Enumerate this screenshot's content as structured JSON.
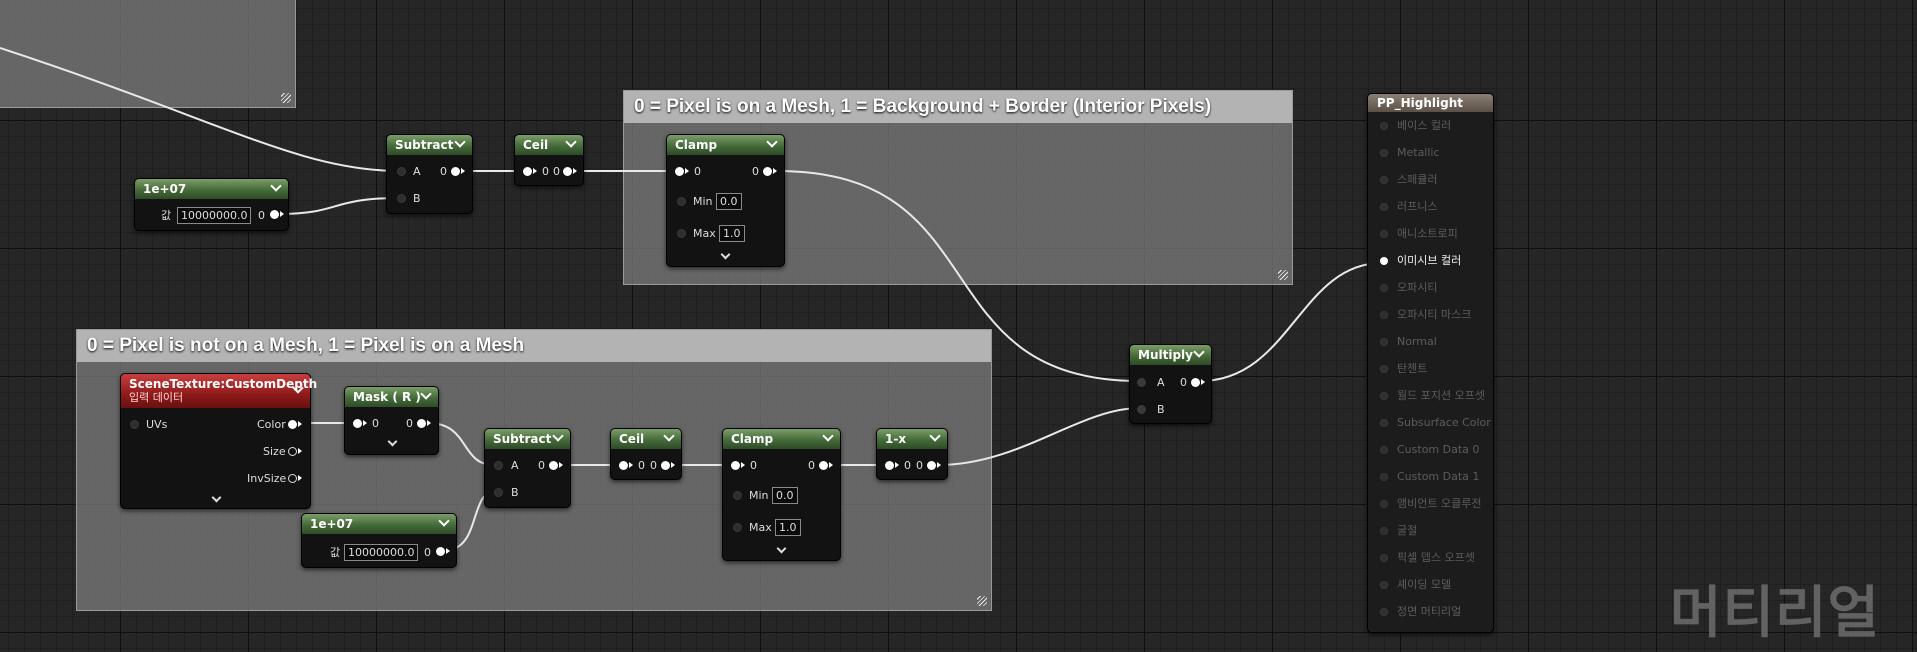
{
  "comments": {
    "top_right": "0 = Pixel is on a Mesh, 1 = Background + Border (Interior Pixels)",
    "bottom": "0 = Pixel is not on a Mesh, 1 = Pixel is on a Mesh"
  },
  "nodes": {
    "const_top": {
      "title": "1e+07",
      "value_label": "값",
      "value": "10000000.0",
      "out_label": "0"
    },
    "subtract_top": {
      "title": "Subtract",
      "pin_a": "A",
      "pin_b": "B",
      "out_label": "0"
    },
    "ceil_top": {
      "title": "Ceil",
      "in_label": "0",
      "out_label": "0"
    },
    "clamp_top": {
      "title": "Clamp",
      "in_label": "0",
      "out_label": "0",
      "min_label": "Min",
      "min_value": "0.0",
      "max_label": "Max",
      "max_value": "1.0"
    },
    "scene_texture": {
      "title": "SceneTexture:CustomDepth",
      "subtitle": "입력 데이터",
      "in_uvs": "UVs",
      "out_color": "Color",
      "out_size": "Size",
      "out_invsize": "InvSize"
    },
    "mask": {
      "title": "Mask ( R )",
      "in_label": "0",
      "out_label": "0"
    },
    "const_bottom": {
      "title": "1e+07",
      "value_label": "값",
      "value": "10000000.0",
      "out_label": "0"
    },
    "subtract_bottom": {
      "title": "Subtract",
      "pin_a": "A",
      "pin_b": "B",
      "out_label": "0"
    },
    "ceil_bottom": {
      "title": "Ceil",
      "in_label": "0",
      "out_label": "0"
    },
    "clamp_bottom": {
      "title": "Clamp",
      "in_label": "0",
      "out_label": "0",
      "min_label": "Min",
      "min_value": "0.0",
      "max_label": "Max",
      "max_value": "1.0"
    },
    "one_minus": {
      "title": "1-x",
      "in_label": "0",
      "out_label": "0"
    },
    "multiply": {
      "title": "Multiply",
      "pin_a": "A",
      "pin_b": "B",
      "out_label": "0"
    }
  },
  "material_output": {
    "title": "PP_Highlight",
    "inputs": [
      {
        "label": "베이스 컬러",
        "active": false
      },
      {
        "label": "Metallic",
        "active": false
      },
      {
        "label": "스페큘러",
        "active": false
      },
      {
        "label": "러프니스",
        "active": false
      },
      {
        "label": "애니소트로피",
        "active": false
      },
      {
        "label": "이미시브 컬러",
        "active": true
      },
      {
        "label": "오파시티",
        "active": false
      },
      {
        "label": "오파시티 마스크",
        "active": false
      },
      {
        "label": "Normal",
        "active": false
      },
      {
        "label": "탄젠트",
        "active": false
      },
      {
        "label": "월드 포지션 오프셋",
        "active": false
      },
      {
        "label": "Subsurface Color",
        "active": false
      },
      {
        "label": "Custom Data 0",
        "active": false
      },
      {
        "label": "Custom Data 1",
        "active": false
      },
      {
        "label": "앰비언트 오클루전",
        "active": false
      },
      {
        "label": "굴절",
        "active": false
      },
      {
        "label": "픽셀 뎁스 오프셋",
        "active": false
      },
      {
        "label": "셰이딩 모델",
        "active": false
      },
      {
        "label": "정면 머티리얼",
        "active": false
      }
    ]
  },
  "watermark": "머티리얼"
}
